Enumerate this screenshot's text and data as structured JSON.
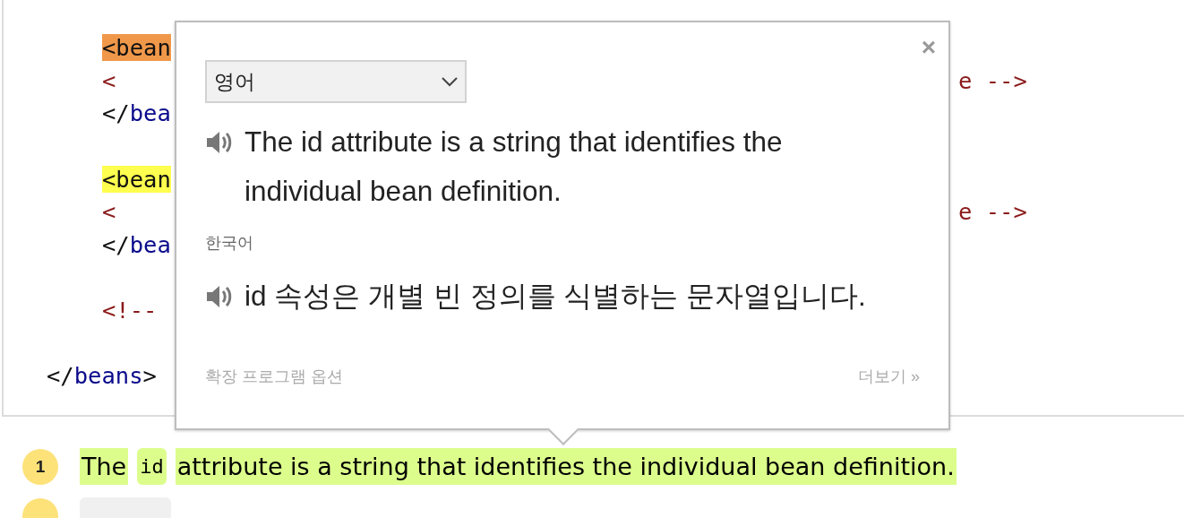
{
  "code_blocks": [
    {
      "lines": [
        {
          "color": "#f0984a",
          "tokens": [
            {
              "kind": "punct",
              "text": "<bean"
            }
          ]
        },
        {
          "tokens": [
            {
              "kind": "comment",
              "text": "<"
            }
          ],
          "right": "e -->"
        },
        {
          "tokens": [
            {
              "kind": "punct",
              "text": "</"
            },
            {
              "kind": "name",
              "text": "bea"
            }
          ]
        }
      ]
    },
    {
      "lines": [
        {
          "color": "#ffff4f",
          "tokens": [
            {
              "kind": "punct",
              "text": "<bean"
            }
          ]
        },
        {
          "tokens": [
            {
              "kind": "comment",
              "text": "<"
            }
          ],
          "right": "e -->"
        },
        {
          "tokens": [
            {
              "kind": "punct",
              "text": "</"
            },
            {
              "kind": "name",
              "text": "bea"
            }
          ]
        }
      ]
    },
    {
      "lines": [
        {
          "tokens": [
            {
              "kind": "comment",
              "text": "<!--"
            }
          ]
        }
      ]
    }
  ],
  "closing_line": {
    "tokens": [
      {
        "kind": "punct",
        "text": "</"
      },
      {
        "kind": "name",
        "text": "beans"
      },
      {
        "kind": "punct",
        "text": ">"
      }
    ]
  },
  "popup": {
    "close": "×",
    "language_select": "영어",
    "source_text": "The id attribute is a string that identifies the individual bean definition.",
    "target_label": "한국어",
    "target_text": "id 속성은 개별 빈 정의를 식별하는 문자열입니다.",
    "options_link": "확장 프로그램 옵션",
    "more_link": "더보기 »"
  },
  "notes": [
    {
      "number": "1",
      "highlighted": true,
      "segments": [
        {
          "kind": "text",
          "text": "The"
        },
        {
          "kind": "code",
          "text": "id"
        },
        {
          "kind": "text",
          "text": "attribute is a string that identifies the individual bean definition."
        }
      ]
    },
    {
      "highlighted": false,
      "segments": [
        {
          "kind": "code"
        }
      ]
    }
  ]
}
